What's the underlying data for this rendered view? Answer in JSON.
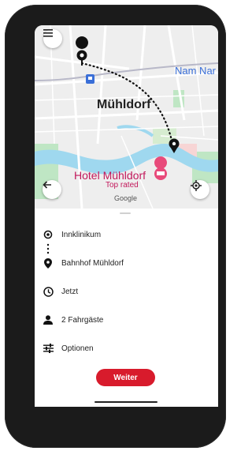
{
  "map": {
    "city_label": "Mühldorf",
    "area_label": "Nam Nar",
    "hotel_name": "Hotel Mühldorf",
    "hotel_tag": "Top rated",
    "attribution": "Google"
  },
  "route": {
    "from": "Innklinikum",
    "to": "Bahnhof Mühldorf",
    "time": "Jetzt",
    "passengers": "2 Fahrgäste",
    "options": "Optionen"
  },
  "actions": {
    "continue_label": "Weiter"
  },
  "colors": {
    "accent": "#d81b2c",
    "map_bg": "#eeeeee",
    "river": "#9fd8ef",
    "park": "#bfe6c4"
  }
}
